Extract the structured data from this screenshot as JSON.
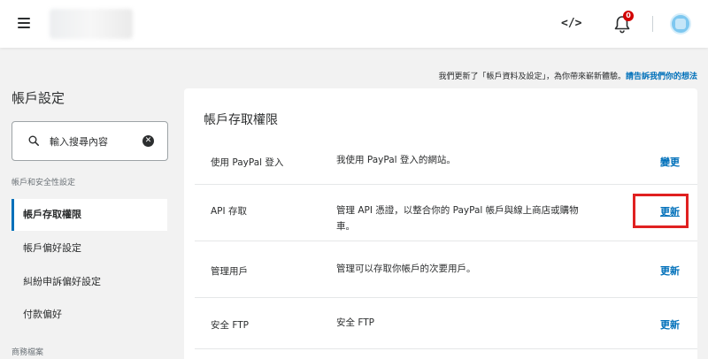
{
  "header": {
    "notification_count": "0"
  },
  "notice": {
    "text": "我們更新了「帳戶資料及設定」，為你帶來嶄新體驗。",
    "link": "請告訴我們你的想法"
  },
  "sidebar": {
    "title": "帳戶設定",
    "search_placeholder": "輸入搜尋內容",
    "section_security": "帳戶和安全性設定",
    "items": [
      {
        "label": "帳戶存取權限"
      },
      {
        "label": "帳戶偏好設定"
      },
      {
        "label": "糾紛申訴偏好設定"
      },
      {
        "label": "付款偏好"
      }
    ],
    "section_business": "商務檔案"
  },
  "panel": {
    "title": "帳戶存取權限",
    "rows": [
      {
        "label": "使用 PayPal 登入",
        "desc": "我使用 PayPal 登入的網站。",
        "action": "變更"
      },
      {
        "label": "API 存取",
        "desc": "管理 API 憑證，以整合你的 PayPal 帳戶與線上商店或購物車。",
        "action": "更新"
      },
      {
        "label": "管理用戶",
        "desc": "管理可以存取你帳戶的次要用戶。",
        "action": "更新"
      },
      {
        "label": "安全 FTP",
        "desc": "安全 FTP",
        "action": "更新"
      }
    ]
  },
  "colors": {
    "accent_blue": "#0070ba",
    "highlight_red": "#e02020",
    "badge_red": "#d20000"
  },
  "icons": {
    "menu": "hamburger-menu-icon",
    "code": "code-brackets-icon",
    "bell": "bell-icon",
    "search": "search-icon",
    "clear": "clear-x-icon"
  }
}
